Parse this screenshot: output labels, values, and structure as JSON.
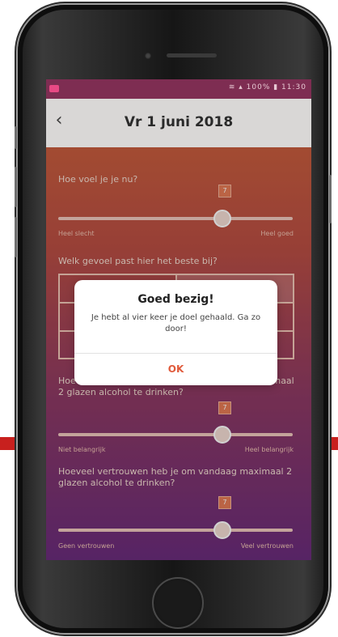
{
  "header": {
    "back_icon": "chevron-left-icon",
    "date": "Vr 1 juni 2018"
  },
  "status_bar": {
    "text": "≋ ▴ 100% ▮ 11:30"
  },
  "questions": [
    {
      "text": "Hoe voel je je nu?",
      "value": "7",
      "left_label": "Heel slecht",
      "right_label": "Heel goed"
    },
    {
      "text": "Welk gevoel past hier het beste bij?"
    },
    {
      "text": "Hoe belangrijk is het voor jou om vandaag maximaal 2 glazen alcohol te drinken?",
      "value": "7",
      "left_label": "Niet belangrijk",
      "right_label": "Heel belangrijk"
    },
    {
      "text": "Hoeveel vertrouwen heb je om vandaag maximaal 2 glazen alcohol te drinken?",
      "value": "7",
      "left_label": "Geen vertrouwen",
      "right_label": "Veel vertrouwen"
    }
  ],
  "dialog": {
    "title": "Goed bezig!",
    "message": "Je hebt al vier keer je doel gehaald. Ga zo door!",
    "ok_label": "OK"
  },
  "colors": {
    "accent": "#e05a3b",
    "status_bar": "#7e2d52",
    "header_bg": "#d9d7d6"
  }
}
